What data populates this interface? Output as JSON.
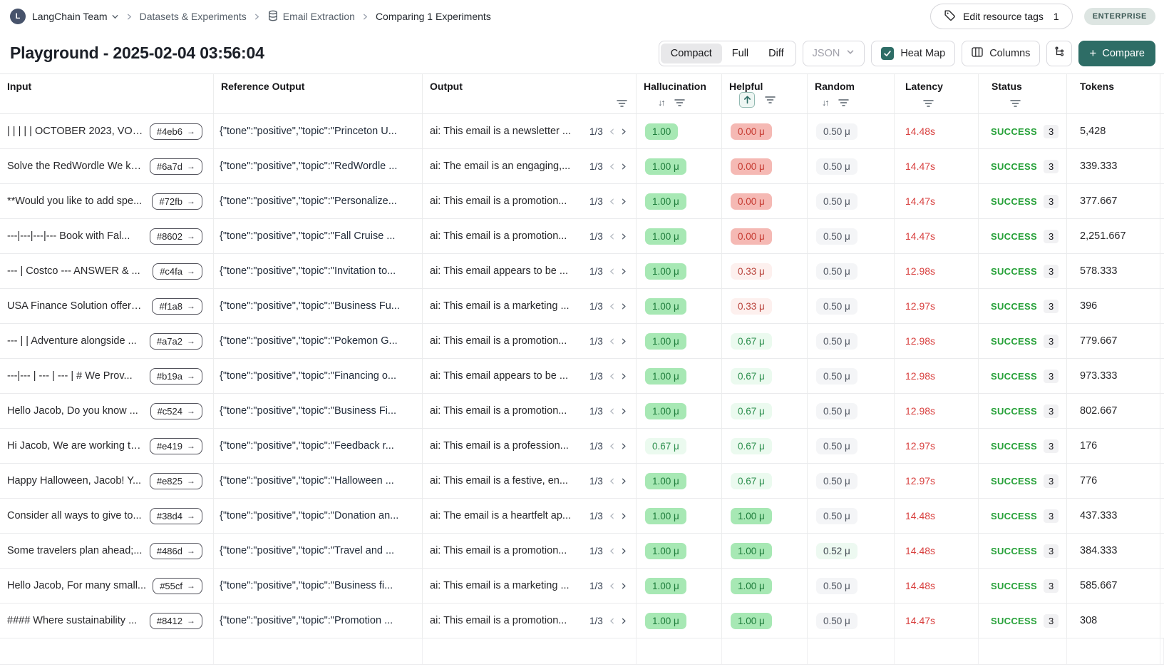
{
  "breadcrumb": {
    "team": "LangChain Team",
    "section": "Datasets & Experiments",
    "dataset": "Email Extraction",
    "current": "Comparing 1 Experiments"
  },
  "header": {
    "edit_tags_label": "Edit resource tags",
    "edit_tags_count": "1",
    "plan_badge": "ENTERPRISE"
  },
  "title": "Playground - 2025-02-04 03:56:04",
  "toolbar": {
    "view_modes": [
      "Compact",
      "Full",
      "Diff"
    ],
    "active_view": "Compact",
    "format_select": "JSON",
    "heatmap_label": "Heat Map",
    "heatmap_checked": true,
    "columns_label": "Columns",
    "compare_label": "Compare"
  },
  "icons": {
    "sort": "↓↑",
    "chip_arrow": "→",
    "pager_prev": "‹",
    "pager_next": "›"
  },
  "table": {
    "columns": [
      {
        "label": "Input"
      },
      {
        "label": "Reference Output"
      },
      {
        "label": "Output"
      },
      {
        "label": "Hallucination"
      },
      {
        "label": "Helpful"
      },
      {
        "label": "Random"
      },
      {
        "label": "Latency"
      },
      {
        "label": "Status"
      },
      {
        "label": "Tokens"
      }
    ],
    "rows": [
      {
        "input": "| | | | | OCTOBER 2023, VOL...",
        "id": "#4eb6",
        "ref": "{\"tone\":\"positive\",\"topic\":\"Princeton U...",
        "output": "ai: This email is a newsletter ...",
        "pager": "1/3",
        "hallucination": {
          "value": "1.00",
          "style": "green"
        },
        "helpful": {
          "value": "0.00 μ",
          "style": "red"
        },
        "random": {
          "value": "0.50 μ",
          "style": "gray"
        },
        "latency": "14.48s",
        "status": "SUCCESS",
        "status_count": "3",
        "tokens": "5,428"
      },
      {
        "input": "Solve the RedWordle We kn...",
        "id": "#6a7d",
        "ref": "{\"tone\":\"positive\",\"topic\":\"RedWordle ...",
        "output": "ai: The email is an engaging,...",
        "pager": "1/3",
        "hallucination": {
          "value": "1.00 μ",
          "style": "green"
        },
        "helpful": {
          "value": "0.00 μ",
          "style": "red"
        },
        "random": {
          "value": "0.50 μ",
          "style": "gray"
        },
        "latency": "14.47s",
        "status": "SUCCESS",
        "status_count": "3",
        "tokens": "339.333"
      },
      {
        "input": "**Would you like to add spe...",
        "id": "#72fb",
        "ref": "{\"tone\":\"positive\",\"topic\":\"Personalize...",
        "output": "ai: This email is a promotion...",
        "pager": "1/3",
        "hallucination": {
          "value": "1.00 μ",
          "style": "green"
        },
        "helpful": {
          "value": "0.00 μ",
          "style": "red"
        },
        "random": {
          "value": "0.50 μ",
          "style": "gray"
        },
        "latency": "14.47s",
        "status": "SUCCESS",
        "status_count": "3",
        "tokens": "377.667"
      },
      {
        "input": "---|---|---|--- Book with Fal...",
        "id": "#8602",
        "ref": "{\"tone\":\"positive\",\"topic\":\"Fall Cruise ...",
        "output": "ai: This email is a promotion...",
        "pager": "1/3",
        "hallucination": {
          "value": "1.00 μ",
          "style": "green"
        },
        "helpful": {
          "value": "0.00 μ",
          "style": "red"
        },
        "random": {
          "value": "0.50 μ",
          "style": "gray"
        },
        "latency": "14.47s",
        "status": "SUCCESS",
        "status_count": "3",
        "tokens": "2,251.667"
      },
      {
        "input": "--- | Costco --- ANSWER & ...",
        "id": "#c4fa",
        "ref": "{\"tone\":\"positive\",\"topic\":\"Invitation to...",
        "output": "ai: This email appears to be ...",
        "pager": "1/3",
        "hallucination": {
          "value": "1.00 μ",
          "style": "green"
        },
        "helpful": {
          "value": "0.33 μ",
          "style": "red-light"
        },
        "random": {
          "value": "0.50 μ",
          "style": "gray"
        },
        "latency": "12.98s",
        "status": "SUCCESS",
        "status_count": "3",
        "tokens": "578.333"
      },
      {
        "input": "USA Finance Solution offers ...",
        "id": "#f1a8",
        "ref": "{\"tone\":\"positive\",\"topic\":\"Business Fu...",
        "output": "ai: This email is a marketing ...",
        "pager": "1/3",
        "hallucination": {
          "value": "1.00 μ",
          "style": "green"
        },
        "helpful": {
          "value": "0.33 μ",
          "style": "red-light"
        },
        "random": {
          "value": "0.50 μ",
          "style": "gray"
        },
        "latency": "12.97s",
        "status": "SUCCESS",
        "status_count": "3",
        "tokens": "396"
      },
      {
        "input": "--- | | Adventure alongside ...",
        "id": "#a7a2",
        "ref": "{\"tone\":\"positive\",\"topic\":\"Pokemon G...",
        "output": "ai: This email is a promotion...",
        "pager": "1/3",
        "hallucination": {
          "value": "1.00 μ",
          "style": "green"
        },
        "helpful": {
          "value": "0.67 μ",
          "style": "green-light"
        },
        "random": {
          "value": "0.50 μ",
          "style": "gray"
        },
        "latency": "12.98s",
        "status": "SUCCESS",
        "status_count": "3",
        "tokens": "779.667"
      },
      {
        "input": "---|--- | --- | --- | # We Prov...",
        "id": "#b19a",
        "ref": "{\"tone\":\"positive\",\"topic\":\"Financing o...",
        "output": "ai: This email appears to be ...",
        "pager": "1/3",
        "hallucination": {
          "value": "1.00 μ",
          "style": "green"
        },
        "helpful": {
          "value": "0.67 μ",
          "style": "green-light"
        },
        "random": {
          "value": "0.50 μ",
          "style": "gray"
        },
        "latency": "12.98s",
        "status": "SUCCESS",
        "status_count": "3",
        "tokens": "973.333"
      },
      {
        "input": "Hello Jacob, Do you know ...",
        "id": "#c524",
        "ref": "{\"tone\":\"positive\",\"topic\":\"Business Fi...",
        "output": "ai: This email is a promotion...",
        "pager": "1/3",
        "hallucination": {
          "value": "1.00 μ",
          "style": "green"
        },
        "helpful": {
          "value": "0.67 μ",
          "style": "green-light"
        },
        "random": {
          "value": "0.50 μ",
          "style": "gray"
        },
        "latency": "12.98s",
        "status": "SUCCESS",
        "status_count": "3",
        "tokens": "802.667"
      },
      {
        "input": "Hi Jacob, We are working to...",
        "id": "#e419",
        "ref": "{\"tone\":\"positive\",\"topic\":\"Feedback r...",
        "output": "ai: This email is a profession...",
        "pager": "1/3",
        "hallucination": {
          "value": "0.67 μ",
          "style": "green-light"
        },
        "helpful": {
          "value": "0.67 μ",
          "style": "green-light"
        },
        "random": {
          "value": "0.50 μ",
          "style": "gray"
        },
        "latency": "12.97s",
        "status": "SUCCESS",
        "status_count": "3",
        "tokens": "176"
      },
      {
        "input": "Happy Halloween, Jacob! Y...",
        "id": "#e825",
        "ref": "{\"tone\":\"positive\",\"topic\":\"Halloween ...",
        "output": "ai: This email is a festive, en...",
        "pager": "1/3",
        "hallucination": {
          "value": "1.00 μ",
          "style": "green"
        },
        "helpful": {
          "value": "0.67 μ",
          "style": "green-light"
        },
        "random": {
          "value": "0.50 μ",
          "style": "gray"
        },
        "latency": "12.97s",
        "status": "SUCCESS",
        "status_count": "3",
        "tokens": "776"
      },
      {
        "input": "Consider all ways to give to...",
        "id": "#38d4",
        "ref": "{\"tone\":\"positive\",\"topic\":\"Donation an...",
        "output": "ai: The email is a heartfelt ap...",
        "pager": "1/3",
        "hallucination": {
          "value": "1.00 μ",
          "style": "green"
        },
        "helpful": {
          "value": "1.00 μ",
          "style": "green"
        },
        "random": {
          "value": "0.50 μ",
          "style": "gray"
        },
        "latency": "14.48s",
        "status": "SUCCESS",
        "status_count": "3",
        "tokens": "437.333"
      },
      {
        "input": "Some travelers plan ahead;...",
        "id": "#486d",
        "ref": "{\"tone\":\"positive\",\"topic\":\"Travel and ...",
        "output": "ai: This email is a promotion...",
        "pager": "1/3",
        "hallucination": {
          "value": "1.00 μ",
          "style": "green"
        },
        "helpful": {
          "value": "1.00 μ",
          "style": "green"
        },
        "random": {
          "value": "0.52 μ",
          "style": "green-faint"
        },
        "latency": "14.48s",
        "status": "SUCCESS",
        "status_count": "3",
        "tokens": "384.333"
      },
      {
        "input": "Hello Jacob, For many small...",
        "id": "#55cf",
        "ref": "{\"tone\":\"positive\",\"topic\":\"Business fi...",
        "output": "ai: This email is a marketing ...",
        "pager": "1/3",
        "hallucination": {
          "value": "1.00 μ",
          "style": "green"
        },
        "helpful": {
          "value": "1.00 μ",
          "style": "green"
        },
        "random": {
          "value": "0.50 μ",
          "style": "gray"
        },
        "latency": "14.48s",
        "status": "SUCCESS",
        "status_count": "3",
        "tokens": "585.667"
      },
      {
        "input": "#### Where sustainability ...",
        "id": "#8412",
        "ref": "{\"tone\":\"positive\",\"topic\":\"Promotion ...",
        "output": "ai: This email is a promotion...",
        "pager": "1/3",
        "hallucination": {
          "value": "1.00 μ",
          "style": "green"
        },
        "helpful": {
          "value": "1.00 μ",
          "style": "green"
        },
        "random": {
          "value": "0.50 μ",
          "style": "gray"
        },
        "latency": "14.47s",
        "status": "SUCCESS",
        "status_count": "3",
        "tokens": "308"
      }
    ]
  },
  "colors": {
    "accent_teal": "#2e6d66",
    "success_green": "#27a139",
    "latency_red": "#d8403f",
    "badge_green_bg": "#a7e8b4",
    "badge_red_bg": "#f5b9b4",
    "badge_gray_bg": "#f4f5f7"
  }
}
